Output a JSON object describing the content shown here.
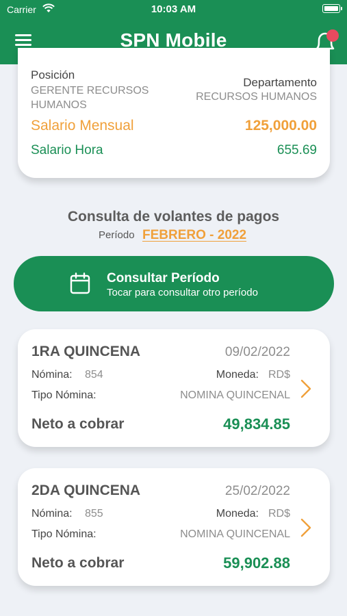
{
  "status_bar": {
    "carrier": "Carrier",
    "time": "10:03 AM"
  },
  "header": {
    "title": "SPN Mobile"
  },
  "employee": {
    "position_label": "Posición",
    "position_value": "GERENTE RECURSOS HUMANOS",
    "department_label": "Departamento",
    "department_value": "RECURSOS HUMANOS",
    "monthly_salary_label": "Salario Mensual",
    "monthly_salary_value": "125,000.00",
    "hourly_salary_label": "Salario Hora",
    "hourly_salary_value": "655.69"
  },
  "consulta": {
    "title": "Consulta de volantes de pagos",
    "period_label": "Período",
    "period_value": "FEBRERO - 2022"
  },
  "consult_button": {
    "title": "Consultar Período",
    "subtitle": "Tocar para consultar otro período"
  },
  "payments": [
    {
      "title": "1RA QUINCENA",
      "date": "09/02/2022",
      "nomina_label": "Nómina:",
      "nomina_value": "854",
      "moneda_label": "Moneda:",
      "moneda_value": "RD$",
      "tipo_label": "Tipo Nómina:",
      "tipo_value": "NOMINA QUINCENAL",
      "neto_label": "Neto a cobrar",
      "neto_value": "49,834.85"
    },
    {
      "title": "2DA QUINCENA",
      "date": "25/02/2022",
      "nomina_label": "Nómina:",
      "nomina_value": "855",
      "moneda_label": "Moneda:",
      "moneda_value": "RD$",
      "tipo_label": "Tipo Nómina:",
      "tipo_value": "NOMINA QUINCENAL",
      "neto_label": "Neto a cobrar",
      "neto_value": "59,902.88"
    }
  ],
  "colors": {
    "primary_green": "#1a8f55",
    "accent_orange": "#f0a03a",
    "notification_red": "#e84a5f",
    "background": "#eef1f6"
  },
  "icons": [
    "wifi-icon",
    "battery-icon",
    "menu-icon",
    "bell-icon",
    "calendar-icon",
    "chevron-right-icon"
  ]
}
